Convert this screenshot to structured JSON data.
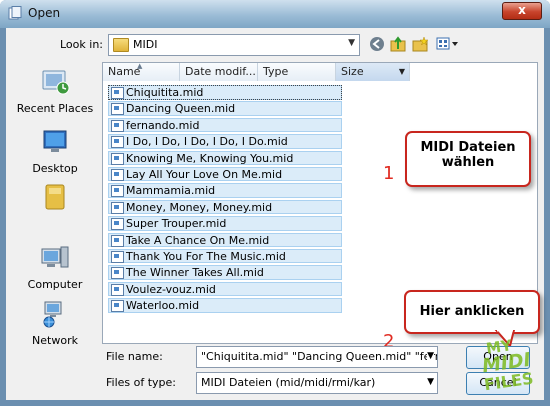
{
  "window": {
    "title": "Open",
    "close_glyph": "x"
  },
  "toolbar": {
    "look_in_label": "Look in:",
    "look_in_value": "MIDI",
    "icons": [
      "back-icon",
      "up-folder-icon",
      "new-folder-icon",
      "views-menu-icon"
    ]
  },
  "places": [
    {
      "label": "Recent Places",
      "icon": "recent-places-icon"
    },
    {
      "label": "Desktop",
      "icon": "desktop-icon"
    },
    {
      "label": "",
      "icon": "user-folder-icon"
    },
    {
      "label": "Computer",
      "icon": "computer-icon"
    },
    {
      "label": "Network",
      "icon": "network-icon"
    }
  ],
  "columns": [
    "Name",
    "Date modif...",
    "Type",
    "Size"
  ],
  "files": [
    "Chiquitita.mid",
    "Dancing Queen.mid",
    "fernando.mid",
    "I Do, I Do, I Do, I Do, I Do.mid",
    "Knowing Me, Knowing You.mid",
    "Lay All Your Love On Me.mid",
    "Mammamia.mid",
    "Money, Money, Money.mid",
    "Super Trouper.mid",
    "Take A Chance On Me.mid",
    "Thank You For The Music.mid",
    "The Winner Takes All.mid",
    "Voulez-vouz.mid",
    "Waterloo.mid"
  ],
  "annotations": {
    "callout1": {
      "line1": "MIDI Dateien",
      "line2": "wählen",
      "number": "1"
    },
    "callout2": {
      "text": "Hier anklicken",
      "number": "2"
    }
  },
  "filename": {
    "label": "File name:",
    "value": "\"Chiquitita.mid\" \"Dancing Queen.mid\" \"fernand"
  },
  "filetype": {
    "label": "Files of type:",
    "value": "MIDI Dateien (mid/midi/rmi/kar)"
  },
  "buttons": {
    "open": "Open",
    "cancel": "Cancel"
  },
  "watermark": {
    "line1": "MY",
    "line2": "MIDI",
    "line3": "FILES"
  },
  "colors": {
    "selection": "#dbecf9",
    "callout_border": "#c8261e",
    "accent_red": "#e02b22",
    "watermark_green": "#7dbb22"
  }
}
